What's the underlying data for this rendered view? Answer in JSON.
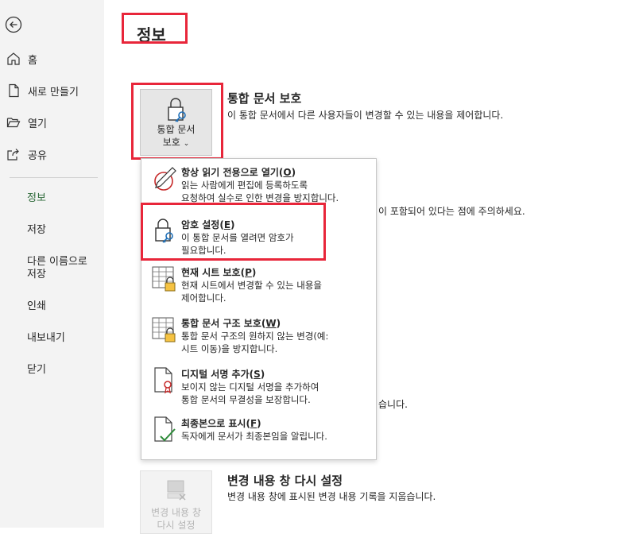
{
  "sidebar": {
    "items": [
      {
        "label": "홈"
      },
      {
        "label": "새로 만들기"
      },
      {
        "label": "열기"
      },
      {
        "label": "공유"
      },
      {
        "label": "정보"
      },
      {
        "label": "저장"
      },
      {
        "label": "다른 이름으로"
      },
      {
        "label": "저장"
      },
      {
        "label": "인쇄"
      },
      {
        "label": "내보내기"
      },
      {
        "label": "닫기"
      }
    ]
  },
  "page": {
    "title": "정보"
  },
  "protect": {
    "button_line1": "통합 문서",
    "button_line2": "보호",
    "title": "통합 문서 보호",
    "desc": "이 통합 문서에서 다른 사용자들이 변경할 수 있는 내용을 제어합니다."
  },
  "background_fragments": {
    "line1": "이 포함되어 있다는 점에 주의하세요.",
    "line2": "습니다."
  },
  "menu": {
    "items": [
      {
        "title": "항상 읽기 전용으로 열기(",
        "key": "O",
        "close": ")",
        "desc1": "읽는 사람에게 편집에 등록하도록",
        "desc2": "요청하여 실수로 인한 변경을 방지합니다."
      },
      {
        "title": "암호 설정(",
        "key": "E",
        "close": ")",
        "desc1": "이 통합 문서를 열려면 암호가",
        "desc2": "필요합니다."
      },
      {
        "title": "현재 시트 보호(",
        "key": "P",
        "close": ")",
        "desc1": "현재 시트에서 변경할 수 있는 내용을",
        "desc2": "제어합니다."
      },
      {
        "title": "통합 문서 구조 보호(",
        "key": "W",
        "close": ")",
        "desc1": "통합 문서 구조의 원하지 않는 변경(예:",
        "desc2": "시트 이동)을 방지합니다."
      },
      {
        "title": "디지털 서명 추가(",
        "key": "S",
        "close": ")",
        "desc1": "보이지 않는 디지털 서명을 추가하여",
        "desc2": "통합 문서의 무결성을 보장합니다."
      },
      {
        "title": "최종본으로 표시(",
        "key": "F",
        "close": ")",
        "desc1": "독자에게 문서가 최종본임을 알립니다.",
        "desc2": ""
      }
    ]
  },
  "changes": {
    "button_line1": "변경 내용 창",
    "button_line2": "다시 설정",
    "title": "변경 내용 창 다시 설정",
    "desc": "변경 내용 창에 표시된 변경 내용 기록을 지웁습니다."
  },
  "colors": {
    "accent_green": "#2f6b3b",
    "highlight_red": "#e8263a",
    "sidebar_bg": "#f3f3f3"
  }
}
